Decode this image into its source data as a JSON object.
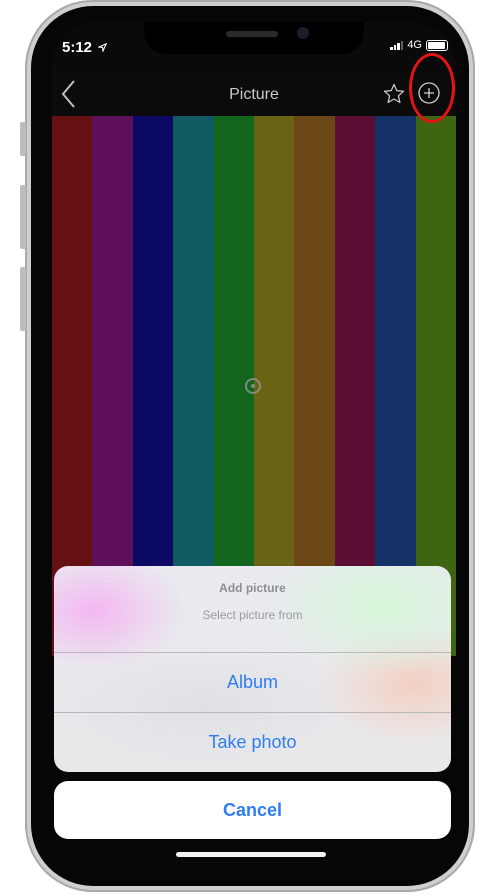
{
  "status_bar": {
    "time": "5:12",
    "network": "4G"
  },
  "navbar": {
    "title": "Picture",
    "back_icon": "chevron-left-icon",
    "star_icon": "star-icon",
    "add_icon": "plus-circle-icon"
  },
  "picture": {
    "bar_colors": [
      "#9b1a1d",
      "#93198d",
      "#110e99",
      "#1a8d97",
      "#1e9b2e",
      "#a09a1f",
      "#a36e1f",
      "#8d1550",
      "#1f4e9b",
      "#5f9b1d"
    ]
  },
  "action_sheet": {
    "title": "Add picture",
    "subtitle": "Select picture from",
    "options": [
      {
        "label": "Album"
      },
      {
        "label": "Take photo"
      }
    ],
    "cancel_label": "Cancel"
  },
  "colors": {
    "accent": "#2f7df1",
    "highlight": "#e31414"
  }
}
